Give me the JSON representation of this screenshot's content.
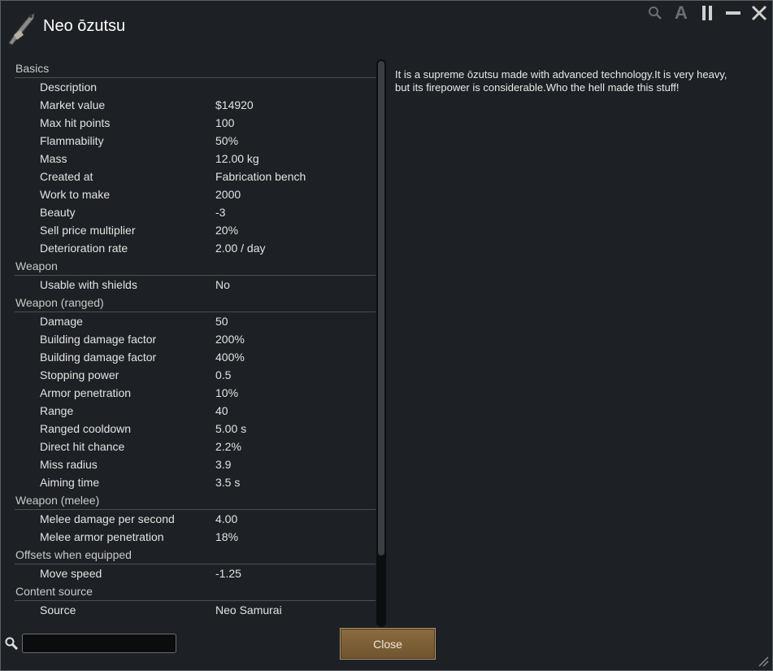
{
  "window": {
    "title": "Neo ōzutsu"
  },
  "controls": [
    {
      "name": "search-icon",
      "glyph": "⚲"
    },
    {
      "name": "font-icon",
      "glyph": "A"
    },
    {
      "name": "pause-icon",
      "glyph": "||"
    },
    {
      "name": "minimize-icon",
      "glyph": "—"
    },
    {
      "name": "close-icon",
      "glyph": "✕"
    }
  ],
  "sections": [
    {
      "header": "Basics",
      "rows": [
        {
          "label": "Description",
          "value": ""
        },
        {
          "label": "Market value",
          "value": "$14920"
        },
        {
          "label": "Max hit points",
          "value": "100"
        },
        {
          "label": "Flammability",
          "value": "50%"
        },
        {
          "label": "Mass",
          "value": "12.00 kg"
        },
        {
          "label": "Created at",
          "value": "Fabrication bench"
        },
        {
          "label": "Work to make",
          "value": "2000"
        },
        {
          "label": "Beauty",
          "value": "-3"
        },
        {
          "label": "Sell price multiplier",
          "value": "20%"
        },
        {
          "label": "Deterioration rate",
          "value": "2.00 / day"
        }
      ]
    },
    {
      "header": "Weapon",
      "rows": [
        {
          "label": "Usable with shields",
          "value": "No"
        }
      ]
    },
    {
      "header": "Weapon (ranged)",
      "rows": [
        {
          "label": "Damage",
          "value": "50"
        },
        {
          "label": "Building damage factor",
          "value": "200%"
        },
        {
          "label": "Building damage factor",
          "value": "400%"
        },
        {
          "label": "Stopping power",
          "value": "0.5"
        },
        {
          "label": "Armor penetration",
          "value": "10%"
        },
        {
          "label": "Range",
          "value": "40"
        },
        {
          "label": "Ranged cooldown",
          "value": "5.00 s"
        },
        {
          "label": "Direct hit chance",
          "value": "2.2%"
        },
        {
          "label": "Miss radius",
          "value": "3.9"
        },
        {
          "label": "Aiming time",
          "value": "3.5 s"
        }
      ]
    },
    {
      "header": "Weapon (melee)",
      "rows": [
        {
          "label": "Melee damage per second",
          "value": "4.00"
        },
        {
          "label": "Melee armor penetration",
          "value": "18%"
        }
      ]
    },
    {
      "header": "Offsets when equipped",
      "rows": [
        {
          "label": "Move speed",
          "value": "-1.25"
        }
      ]
    },
    {
      "header": "Content source",
      "rows": [
        {
          "label": "Source",
          "value": "Neo Samurai"
        }
      ]
    }
  ],
  "description": "It is a supreme ōzutsu made with advanced technology.It is very heavy, but its firepower is considerable.Who the hell made this stuff!",
  "search": {
    "value": ""
  },
  "close_button": {
    "label": "Close"
  },
  "colors": {
    "accent_button": "#7d6137",
    "background": "#1d2125"
  }
}
